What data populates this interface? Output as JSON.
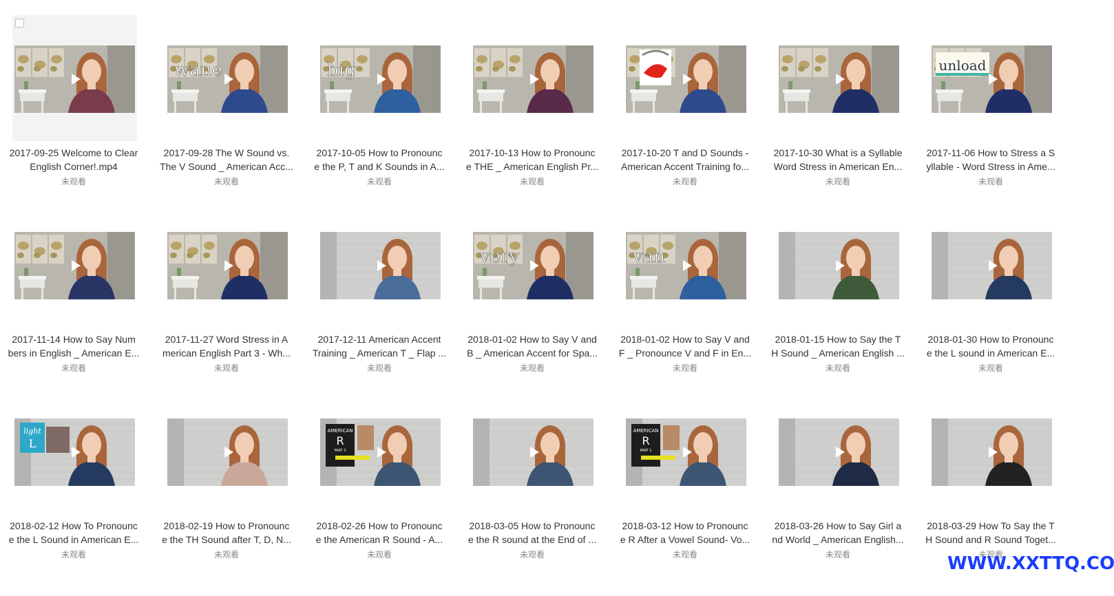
{
  "videos": [
    {
      "title_line1": "2017-09-25 Welcome to Clear",
      "title_line2": "English Corner!.mp4",
      "status": "未观看",
      "overlay_text": "",
      "scene": "map",
      "shirt": "#7a3c4a",
      "hovered": true
    },
    {
      "title_line1": "2017-09-28 The W Sound vs.",
      "title_line2": "The V Sound _ American Acc...",
      "status": "未观看",
      "overlay_text": "wane",
      "scene": "map",
      "shirt": "#2e4a8c",
      "hovered": false
    },
    {
      "title_line1": "2017-10-05 How to Pronounc",
      "title_line2": "e the P, T and K Sounds in A...",
      "status": "未观看",
      "overlay_text": "big",
      "scene": "map",
      "shirt": "#2e5f9e",
      "hovered": false
    },
    {
      "title_line1": "2017-10-13 How to Pronounc",
      "title_line2": "e THE _ American English Pr...",
      "status": "未观看",
      "overlay_text": "",
      "scene": "map",
      "shirt": "#5a2a4a",
      "hovered": false
    },
    {
      "title_line1": "2017-10-20 T and D Sounds -",
      "title_line2": "American Accent Training fo...",
      "status": "未观看",
      "overlay_text": "",
      "scene": "map-mouth",
      "shirt": "#2e4a8c",
      "hovered": false
    },
    {
      "title_line1": "2017-10-30 What is a Syllable",
      "title_line2": "Word Stress in American En...",
      "status": "未观看",
      "overlay_text": "",
      "scene": "map",
      "shirt": "#1f2f66",
      "hovered": false
    },
    {
      "title_line1": "2017-11-06 How to Stress a S",
      "title_line2": "yllable - Word Stress in Ame...",
      "status": "未观看",
      "overlay_text": "unload",
      "scene": "map-card",
      "shirt": "#1f2f66",
      "hovered": false
    },
    {
      "title_line1": "2017-11-14 How to Say Num",
      "title_line2": "bers in English _ American E...",
      "status": "未观看",
      "overlay_text": "",
      "scene": "map",
      "shirt": "#2a3566",
      "hovered": false
    },
    {
      "title_line1": "2017-11-27 Word Stress in A",
      "title_line2": "merican English Part 3 - Wh...",
      "status": "未观看",
      "overlay_text": "",
      "scene": "map",
      "shirt": "#1f2f66",
      "hovered": false
    },
    {
      "title_line1": "2017-12-11 American Accent",
      "title_line2": "Training _ American T _ Flap ...",
      "status": "未观看",
      "overlay_text": "",
      "scene": "brick",
      "shirt": "#4a6d99",
      "hovered": false
    },
    {
      "title_line1": "2018-01-02 How to Say V and",
      "title_line2": "B _ American Accent for Spa...",
      "status": "未观看",
      "overlay_text": "very",
      "scene": "map",
      "shirt": "#1f2f66",
      "hovered": false
    },
    {
      "title_line1": "2018-01-02 How to Say V and",
      "title_line2": "F _ Pronounce V and F in En...",
      "status": "未观看",
      "overlay_text": "van",
      "scene": "map",
      "shirt": "#2e5f9e",
      "hovered": false
    },
    {
      "title_line1": "2018-01-15 How to Say the T",
      "title_line2": "H Sound _ American English ...",
      "status": "未观看",
      "overlay_text": "",
      "scene": "brick",
      "shirt": "#3f5a3a",
      "hovered": false
    },
    {
      "title_line1": "2018-01-30 How to Pronounc",
      "title_line2": "e the L sound in American E...",
      "status": "未观看",
      "overlay_text": "",
      "scene": "brick",
      "shirt": "#243a5e",
      "hovered": false
    },
    {
      "title_line1": "2018-02-12 How To Pronounc",
      "title_line2": "e the L Sound in American E...",
      "status": "未观看",
      "overlay_text": "light L",
      "scene": "brick-card-blue",
      "shirt": "#243a5e",
      "hovered": false
    },
    {
      "title_line1": "2018-02-19 How to Pronounc",
      "title_line2": "e the TH Sound after T, D, N...",
      "status": "未观看",
      "overlay_text": "",
      "scene": "brick",
      "shirt": "#c9a89a",
      "hovered": false
    },
    {
      "title_line1": "2018-02-26 How to Pronounc",
      "title_line2": "e the American R Sound - A...",
      "status": "未观看",
      "overlay_text": "AMERICAN R PART 3",
      "scene": "brick-card-dark",
      "shirt": "#3d5573",
      "hovered": false
    },
    {
      "title_line1": "2018-03-05 How to Pronounc",
      "title_line2": "e the R sound at the End of ...",
      "status": "未观看",
      "overlay_text": "",
      "scene": "brick",
      "shirt": "#3d5573",
      "hovered": false
    },
    {
      "title_line1": "2018-03-12 How to Pronounc",
      "title_line2": "e R After a Vowel Sound- Vo...",
      "status": "未观看",
      "overlay_text": "AMERICAN R PART 1",
      "scene": "brick-card-dark",
      "shirt": "#3d5573",
      "hovered": false
    },
    {
      "title_line1": "2018-03-26 How to Say Girl a",
      "title_line2": "nd World _ American English...",
      "status": "未观看",
      "overlay_text": "",
      "scene": "brick",
      "shirt": "#1f2a44",
      "hovered": false
    },
    {
      "title_line1": "2018-03-29 How To Say the T",
      "title_line2": "H Sound and R Sound Toget...",
      "status": "未观看",
      "overlay_text": "",
      "scene": "brick",
      "shirt": "#222222",
      "hovered": false
    }
  ],
  "watermark": "WWW.XXTTQ.COM",
  "colors": {
    "title_text": "#333333",
    "status_text": "#888888",
    "watermark": "#1a3cff",
    "hover_bg": "#f3f3f3"
  }
}
